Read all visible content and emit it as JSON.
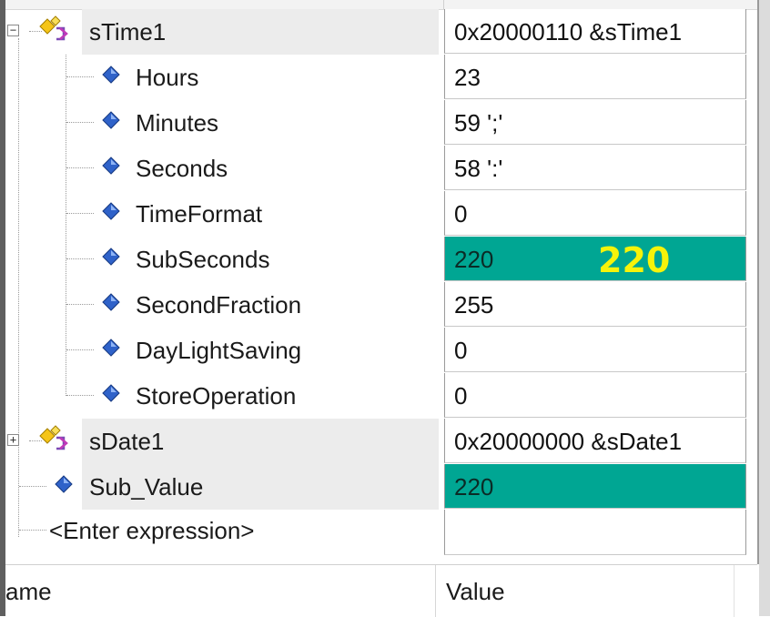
{
  "watch": {
    "rows": [
      {
        "name": "sTime1",
        "value": "0x20000110 &sTime1",
        "expander": "−"
      },
      {
        "name": "Hours",
        "value": "23"
      },
      {
        "name": "Minutes",
        "value": "59 ';'"
      },
      {
        "name": "Seconds",
        "value": "58 ':'"
      },
      {
        "name": "TimeFormat",
        "value": "0"
      },
      {
        "name": "SubSeconds",
        "value": "220",
        "overlay": "220"
      },
      {
        "name": "SecondFraction",
        "value": "255"
      },
      {
        "name": "DayLightSaving",
        "value": "0"
      },
      {
        "name": "StoreOperation",
        "value": "0"
      },
      {
        "name": "sDate1",
        "value": "0x20000000 &sDate1",
        "expander": "+"
      },
      {
        "name": "Sub_Value",
        "value": "220"
      },
      {
        "name": "<Enter expression>",
        "value": ""
      }
    ],
    "header": {
      "name_label": "ame",
      "value_label": "Value"
    }
  },
  "colors": {
    "highlight_value": "#00a693",
    "overlay_text": "#f6f30a",
    "row_highlight": "#ececec"
  },
  "icons": {
    "struct": "struct-variable-icon",
    "field": "field-member-icon"
  }
}
